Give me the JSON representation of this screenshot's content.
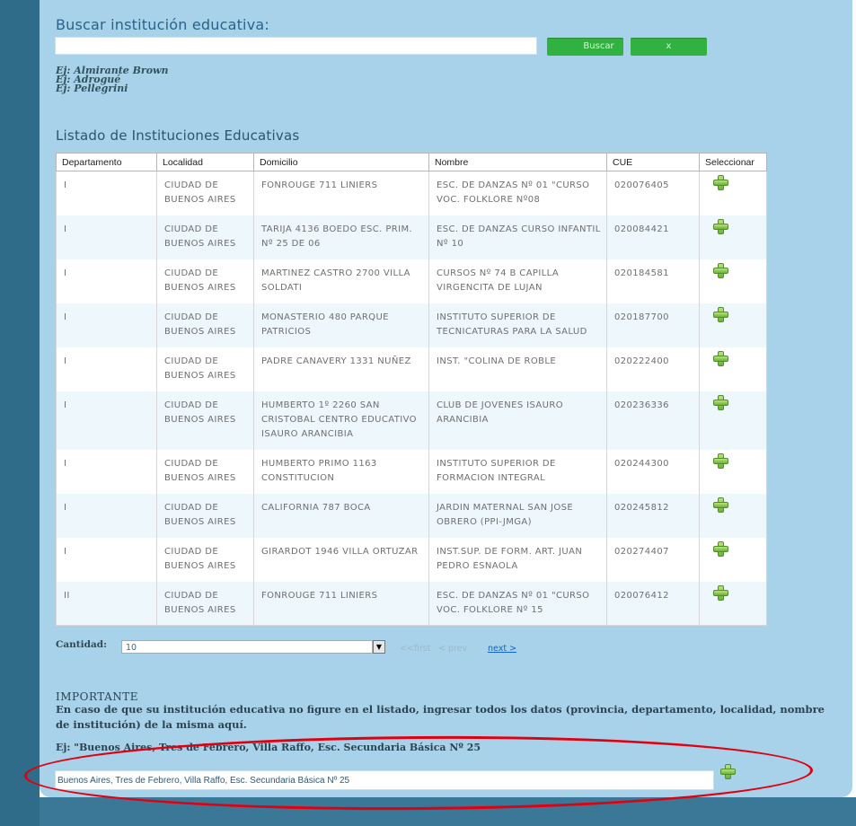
{
  "search": {
    "title": "Buscar institución educativa:",
    "value": "",
    "search_button": "Buscar",
    "clear_button": "x",
    "examples": [
      "Ej: Almirante Brown",
      "Ej: Adrogué",
      "Ej: Pellegrini"
    ]
  },
  "list": {
    "title": "Listado de Instituciones Educativas",
    "columns": [
      "Departamento",
      "Localidad",
      "Domicilio",
      "Nombre",
      "CUE",
      "Seleccionar"
    ],
    "rows": [
      {
        "dep": "I",
        "loc": "CIUDAD DE BUENOS AIRES",
        "dom": "FONROUGE 711 LINIERS",
        "nom": "ESC. DE DANZAS Nº 01 \"CURSO VOC. FOLKLORE Nº08",
        "cue": "020076405"
      },
      {
        "dep": "I",
        "loc": "CIUDAD DE BUENOS AIRES",
        "dom": "TARIJA 4136 BOEDO ESC. PRIM. Nº 25 DE 06",
        "nom": "ESC. DE DANZAS CURSO INFANTIL Nº 10",
        "cue": "020084421"
      },
      {
        "dep": "I",
        "loc": "CIUDAD DE BUENOS AIRES",
        "dom": "MARTINEZ CASTRO 2700 VILLA SOLDATI",
        "nom": "CURSOS Nº 74 B CAPILLA VIRGENCITA DE LUJAN",
        "cue": "020184581"
      },
      {
        "dep": "I",
        "loc": "CIUDAD DE BUENOS AIRES",
        "dom": "MONASTERIO 480 PARQUE PATRICIOS",
        "nom": "INSTITUTO SUPERIOR DE TECNICATURAS PARA LA SALUD",
        "cue": "020187700"
      },
      {
        "dep": "I",
        "loc": "CIUDAD DE BUENOS AIRES",
        "dom": "PADRE CANAVERY 1331 NUÑEZ",
        "nom": "INST. \"COLINA DE ROBLE",
        "cue": "020222400"
      },
      {
        "dep": "I",
        "loc": "CIUDAD DE BUENOS AIRES",
        "dom": "HUMBERTO 1º 2260 SAN CRISTOBAL CENTRO EDUCATIVO ISAURO ARANCIBIA",
        "nom": "CLUB DE JOVENES ISAURO ARANCIBIA",
        "cue": "020236336"
      },
      {
        "dep": "I",
        "loc": "CIUDAD DE BUENOS AIRES",
        "dom": "HUMBERTO PRIMO 1163 CONSTITUCION",
        "nom": "INSTITUTO SUPERIOR DE FORMACION INTEGRAL",
        "cue": "020244300"
      },
      {
        "dep": "I",
        "loc": "CIUDAD DE BUENOS AIRES",
        "dom": "CALIFORNIA 787 BOCA",
        "nom": "JARDIN MATERNAL SAN JOSE OBRERO (PPI-JMGA)",
        "cue": "020245812"
      },
      {
        "dep": "I",
        "loc": "CIUDAD DE BUENOS AIRES",
        "dom": "GIRARDOT 1946 VILLA ORTUZAR",
        "nom": "INST.SUP. DE FORM. ART. JUAN PEDRO ESNAOLA",
        "cue": "020274407"
      },
      {
        "dep": "II",
        "loc": "CIUDAD DE BUENOS AIRES",
        "dom": "FONROUGE 711 LINIERS",
        "nom": "ESC. DE DANZAS Nº 01 \"CURSO VOC. FOLKLORE Nº 15",
        "cue": "020076412"
      }
    ]
  },
  "pagination": {
    "quantity_label": "Cantidad:",
    "quantity_value": "10",
    "first": "<<first",
    "prev": "< prev",
    "next": "next >"
  },
  "important": {
    "title": "IMPORTANTE",
    "text": "En caso de que su institución educativa no figure en el listado, ingresar todos los datos (provincia, departamento, localidad, nombre de institución) de la misma aquí.",
    "example": "Ej: \"Buenos Aires, Tres de Febrero, Villa Raffo, Esc. Secundaria Básica Nº 25",
    "input_value": "Buenos Aires, Tres de Febrero, Villa Raffo, Esc. Secundaria Básica Nº 25"
  },
  "colors": {
    "panel": "#a8d2e9",
    "left_strip": "#2f6c8a",
    "button_green": "#31b13f",
    "highlight_ellipse": "#e10010",
    "link_blue": "#1363c8"
  }
}
